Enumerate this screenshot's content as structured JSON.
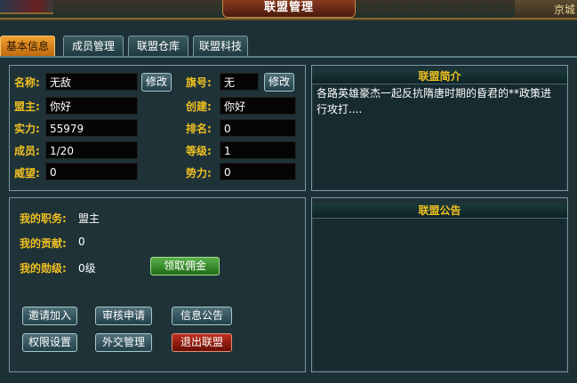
{
  "window": {
    "title": "联盟管理",
    "corner_text": "京城"
  },
  "tabs": [
    {
      "label": "基本信息",
      "active": true
    },
    {
      "label": "成员管理",
      "active": false
    },
    {
      "label": "联盟仓库",
      "active": false
    },
    {
      "label": "联盟科技",
      "active": false
    }
  ],
  "info": {
    "name_label": "名称:",
    "name_value": "无敌",
    "flag_label": "旗号:",
    "flag_value": "无",
    "leader_label": "盟主:",
    "leader_value": "你好",
    "creator_label": "创建:",
    "creator_value": "你好",
    "power_label": "实力:",
    "power_value": "55979",
    "rank_label": "排名:",
    "rank_value": "0",
    "members_label": "成员:",
    "members_value": "1/20",
    "level_label": "等级:",
    "level_value": "1",
    "prestige_label": "威望:",
    "prestige_value": "0",
    "force_label": "势力:",
    "force_value": "0",
    "modify_label": "修改"
  },
  "my": {
    "position_label": "我的职务:",
    "position_value": "盟主",
    "contribution_label": "我的贡献:",
    "contribution_value": "0",
    "merit_label": "我的勋级:",
    "merit_value": "0级",
    "collect_label": "领取佣金"
  },
  "actions": {
    "invite": "邀请加入",
    "review": "审核申请",
    "notice": "信息公告",
    "permission": "权限设置",
    "diplomacy": "外交管理",
    "quit": "退出联盟"
  },
  "intro_panel": {
    "title": "联盟简介",
    "text": "各路英雄豪杰一起反抗隋唐时期的昏君的**政策进行攻打...."
  },
  "notice_panel": {
    "title": "联盟公告"
  },
  "colors": {
    "accent": "#f0c020",
    "tab_active": "#e08a20",
    "button_green": "#2e8a22",
    "button_red": "#9a1a0c"
  }
}
